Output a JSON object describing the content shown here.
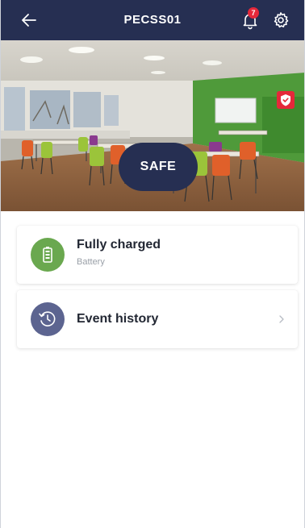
{
  "header": {
    "title": "PECSS01",
    "notification_count": "7",
    "background_color": "#262f52"
  },
  "camera": {
    "status_label": "SAFE",
    "status_pill_color": "#262f52",
    "shield_icon": "shield-check-icon",
    "shield_color": "#e5283a",
    "waves_icon": "heat-waves-icon"
  },
  "cards": {
    "battery": {
      "title": "Fully charged",
      "subtitle": "Battery",
      "icon": "battery-icon",
      "icon_color": "#6aa84f"
    },
    "history": {
      "title": "Event history",
      "icon": "history-clock-icon",
      "icon_color": "#5c6490"
    }
  },
  "colors": {
    "accent": "#262f52",
    "danger": "#e5283a",
    "success": "#6aa84f"
  }
}
